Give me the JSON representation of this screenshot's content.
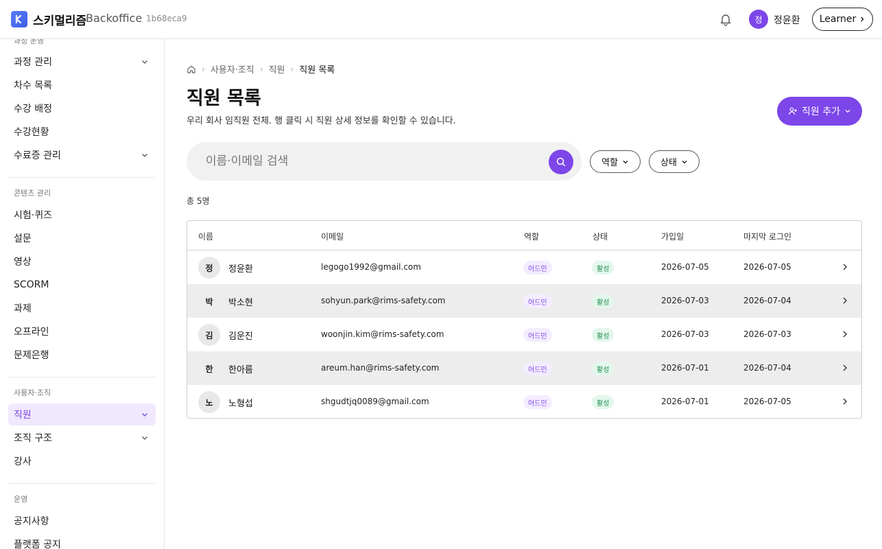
{
  "header": {
    "brand": "스키멀리즘",
    "brand_sub": "Backoffice",
    "build": "1b68eca9",
    "user_initial": "정",
    "user_name": "정윤환",
    "learner_label": "Learner"
  },
  "sidebar": {
    "sections": [
      {
        "label": "과정 운영"
      },
      {
        "label": "콘텐츠 관리"
      },
      {
        "label": "사용자·조직"
      },
      {
        "label": "운영"
      }
    ],
    "items": [
      {
        "label": "과정 관리"
      },
      {
        "label": "차수 목록"
      },
      {
        "label": "수강 배정"
      },
      {
        "label": "수강현황"
      },
      {
        "label": "수료증 관리"
      },
      {
        "label": "시험·퀴즈"
      },
      {
        "label": "설문"
      },
      {
        "label": "영상"
      },
      {
        "label": "SCORM"
      },
      {
        "label": "과제"
      },
      {
        "label": "오프라인"
      },
      {
        "label": "문제은행"
      },
      {
        "label": "직원"
      },
      {
        "label": "조직 구조"
      },
      {
        "label": "강사"
      },
      {
        "label": "공지사항"
      },
      {
        "label": "플랫폼 공지"
      }
    ]
  },
  "breadcrumb": [
    "사용자·조직",
    "직원",
    "직원 목록"
  ],
  "page": {
    "title": "직원 목록",
    "description": "우리 회사 임직원 전체. 행 클릭 시 직원 상세 정보를 확인할 수 있습니다.",
    "add_button": "직원 추가",
    "search_placeholder": "이름·이메일 검색",
    "filter_role": "역할",
    "filter_status": "상태",
    "total": "총 5명"
  },
  "table": {
    "columns": [
      "이름",
      "이메일",
      "역할",
      "상태",
      "가입일",
      "마지막 로그인"
    ],
    "rows": [
      {
        "initial": "정",
        "name": "정윤환",
        "email": "legogo1992@gmail.com",
        "role": "어드민",
        "status": "활성",
        "joined": "2026-07-05",
        "last_login": "2026-07-05"
      },
      {
        "initial": "박",
        "name": "박소현",
        "email": "sohyun.park@rims-safety.com",
        "role": "어드민",
        "status": "활성",
        "joined": "2026-07-03",
        "last_login": "2026-07-04"
      },
      {
        "initial": "김",
        "name": "김운진",
        "email": "woonjin.kim@rims-safety.com",
        "role": "어드민",
        "status": "활성",
        "joined": "2026-07-03",
        "last_login": "2026-07-03"
      },
      {
        "initial": "한",
        "name": "한아름",
        "email": "areum.han@rims-safety.com",
        "role": "어드민",
        "status": "활성",
        "joined": "2026-07-01",
        "last_login": "2026-07-04"
      },
      {
        "initial": "노",
        "name": "노형섭",
        "email": "shgudtjq0089@gmail.com",
        "role": "어드민",
        "status": "활성",
        "joined": "2026-07-01",
        "last_login": "2026-07-05"
      }
    ]
  },
  "colors": {
    "accent": "#7c46e8",
    "active_bg": "#f0e8fd",
    "status_green": "#1e8a4c"
  },
  "icons": [
    "logo-icon",
    "bell-icon",
    "chevron-down-icon",
    "home-icon",
    "search-icon",
    "user-plus-icon",
    "chevron-right-icon"
  ]
}
